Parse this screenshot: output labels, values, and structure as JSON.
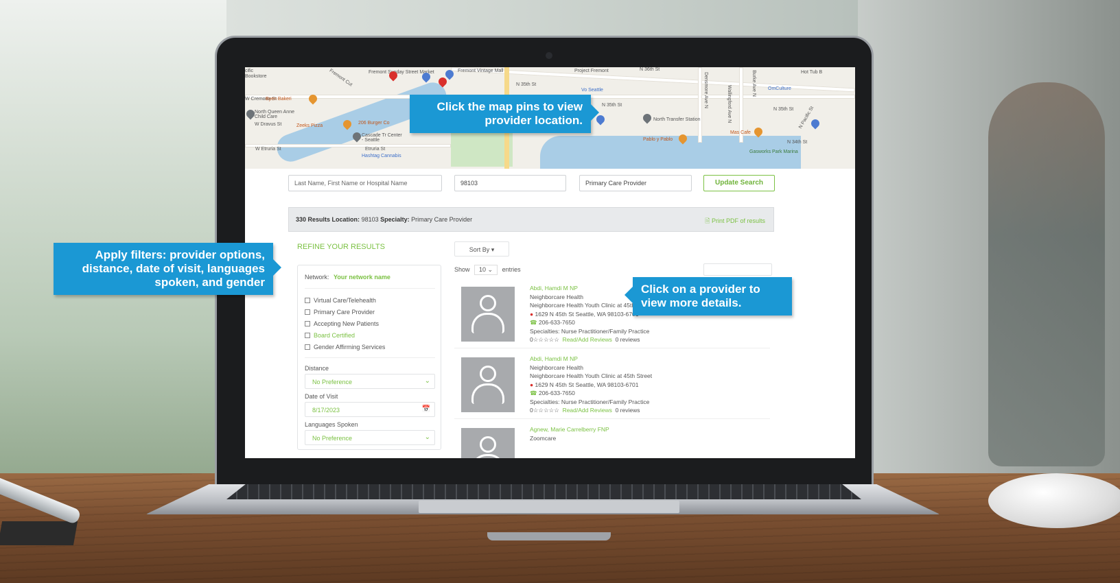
{
  "map": {
    "labels": [
      "cific",
      "Bookstore",
      "Fremont Cut",
      "Fremont Sunday Street Market",
      "Fremont Vintage Mall",
      "N 35th St",
      "Project Fremont",
      "N 36th St",
      "Hot Tub B",
      "W Cremona St",
      "Byen Bakeri",
      "North Queen Anne Child Care",
      "W Dravus St",
      "Zeeks Pizza",
      "206 Burger Co",
      "Cascade Tr Center - Seattle",
      "W Etruria St",
      "Etruria St",
      "Hashtag Cannabis",
      "Vo Seattle",
      "N 35th St",
      "North Transfer Station",
      "OmCulture",
      "N 35th St",
      "Mas Cafe",
      "Pablo y Pablo",
      "N 34th St",
      "Gasworks Park Marina",
      "Wallingford Ave N",
      "Burke Ave N",
      "Densmore Ave N",
      "N Pacific St"
    ]
  },
  "search": {
    "name_placeholder": "Last Name, First Name or Hospital Name",
    "zip_value": "98103",
    "specialty_value": "Primary Care Provider",
    "update_button": "Update Search"
  },
  "results_bar": {
    "count_label": "330 Results",
    "location_label": "Location:",
    "location_value": "98103",
    "specialty_label": "Specialty:",
    "specialty_value": "Primary Care Provider",
    "print_pdf": "Print PDF of results"
  },
  "refine": {
    "title": "REFINE YOUR RESULTS",
    "network_label": "Network:",
    "network_value": "Your network name",
    "checkboxes": [
      "Virtual Care/Telehealth",
      "Primary Care Provider",
      "Accepting New Patients",
      "Board Certified",
      "Gender Affirming Services"
    ],
    "distance_label": "Distance",
    "distance_value": "No Preference",
    "date_label": "Date of Visit",
    "date_value": "8/17/2023",
    "languages_label": "Languages Spoken",
    "languages_value": "No Preference"
  },
  "list": {
    "sort_by": "Sort By ▾",
    "show_label": "Show",
    "entries_value": "10",
    "entries_label": "entries"
  },
  "providers": [
    {
      "name": "Abdi, Hamdi M  NP",
      "org": "Neighborcare Health",
      "clinic": "Neighborcare Health Youth Clinic at 45th Street",
      "address": "1629 N 45th St Seattle, WA 98103-6701",
      "phone": "206-633-7650",
      "specialties": "Specialties: Nurse Practitioner/Family Practice",
      "rating": "0☆☆☆☆☆",
      "reviews_link": "Read/Add Reviews",
      "reviews_count": "0 reviews"
    },
    {
      "name": "Abdi, Hamdi M  NP",
      "org": "Neighborcare Health",
      "clinic": "Neighborcare Health Youth Clinic at 45th Street",
      "address": "1629 N 45th St Seattle, WA 98103-6701",
      "phone": "206-633-7650",
      "specialties": "Specialties: Nurse Practitioner/Family Practice",
      "rating": "0☆☆☆☆☆",
      "reviews_link": "Read/Add Reviews",
      "reviews_count": "0 reviews"
    },
    {
      "name": "Agnew, Marie Carrelberry  FNP",
      "org": "Zoomcare"
    }
  ],
  "callouts": {
    "map_pins": "Click the map pins to view provider location.",
    "filters": "Apply filters: provider options, distance, date of visit, languages spoken, and gender",
    "provider": "Click on a provider to view more details."
  },
  "colors": {
    "accent_green": "#7bc143",
    "callout_blue": "#1b98d4",
    "pin_red": "#d9302c"
  }
}
